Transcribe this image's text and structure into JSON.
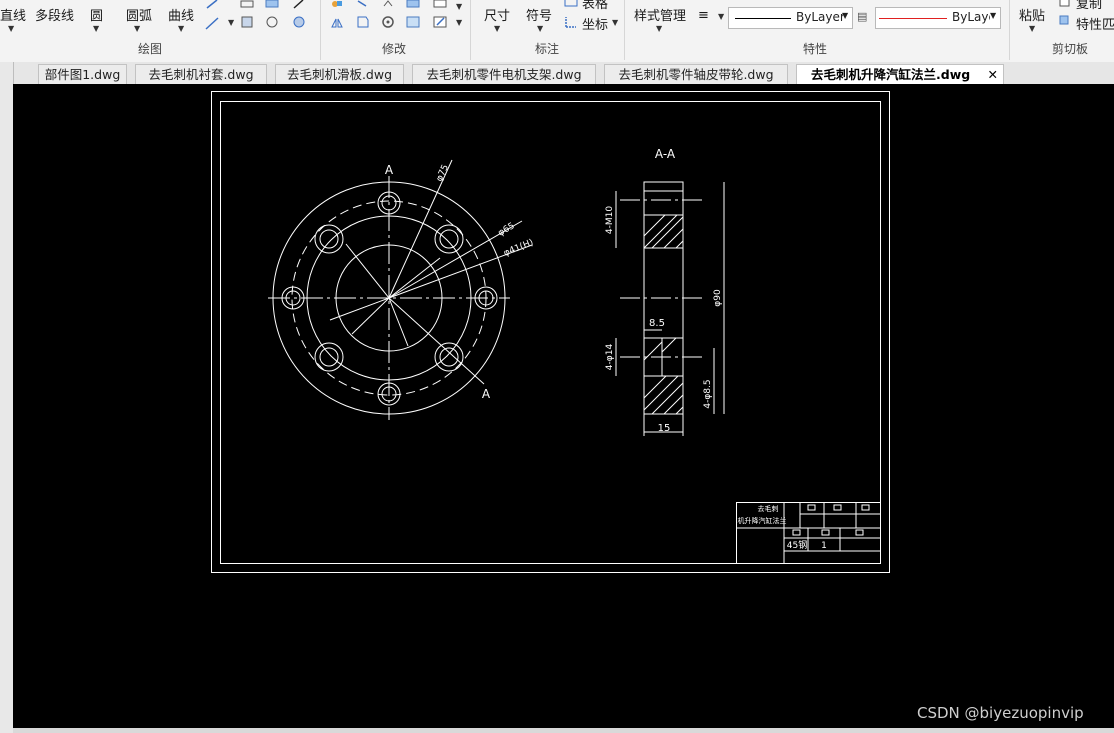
{
  "ribbon": {
    "draw": {
      "line": "直线",
      "polyline": "多段线",
      "circle": "圆",
      "arc": "圆弧",
      "curve": "曲线",
      "group": "绘图"
    },
    "modify": {
      "group": "修改"
    },
    "annotate": {
      "dimension": "尺寸",
      "symbol": "符号",
      "table": "表格",
      "coordinate": "坐标",
      "group": "标注"
    },
    "properties": {
      "style_manager": "样式管理",
      "layer1": "ByLayer",
      "layer2": "ByLayer",
      "group": "特性",
      "layer1_color": "#000000",
      "layer2_color": "#e02020"
    },
    "clipboard": {
      "paste": "粘贴",
      "copy": "复制",
      "match_props": "特性匹",
      "group": "剪切板"
    }
  },
  "tabs": [
    {
      "label": "部件图1.dwg"
    },
    {
      "label": "去毛刺机衬套.dwg"
    },
    {
      "label": "去毛刺机滑板.dwg"
    },
    {
      "label": "去毛刺机零件电机支架.dwg"
    },
    {
      "label": "去毛刺机零件轴皮带轮.dwg"
    },
    {
      "label": "去毛刺机升降汽缸法兰.dwg",
      "active": true
    }
  ],
  "drawing": {
    "section_label": "A-A",
    "cut_label_top": "A",
    "cut_label_bottom": "A",
    "dims": {
      "d75": "φ75",
      "d65": "φ65",
      "d41": "φ41(H)",
      "m10": "4-M10",
      "d90": "φ90",
      "w85": "8.5",
      "d14": "4-φ14",
      "d85": "4-φ8.5",
      "w15": "15"
    },
    "title_block": {
      "name1": "去毛刺",
      "name2": "机升降汽缸法兰",
      "material": "45钢",
      "qty": "1"
    }
  },
  "watermark": "CSDN @biyezuopinvip"
}
